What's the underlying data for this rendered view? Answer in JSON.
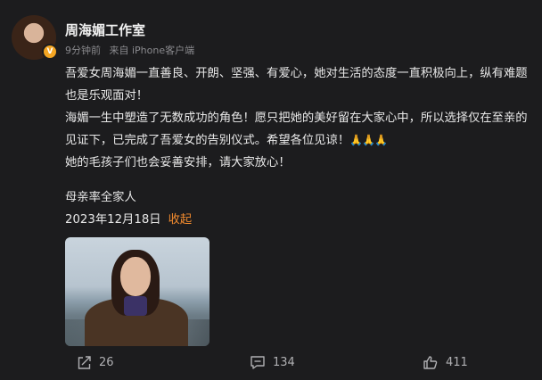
{
  "post": {
    "author": "周海媚工作室",
    "time": "9分钟前",
    "source": "来自 iPhone客户端",
    "paragraphs": [
      "吾爱女周海媚一直善良、开朗、坚强、有爱心，她对生活的态度一直积极向上，纵有难题也是乐观面对！",
      "海媚一生中塑造了无数成功的角色！愿只把她的美好留在大家心中，所以选择仅在至亲的见证下，已完成了吾爱女的告别仪式。希望各位见谅！",
      "她的毛孩子们也会妥善安排，请大家放心！"
    ],
    "emoji": "🙏",
    "signature": "母亲率全家人",
    "date": "2023年12月18日",
    "collapse_label": "收起"
  },
  "actions": {
    "share_count": "26",
    "comment_count": "134",
    "like_count": "411"
  },
  "icons": {
    "verified": "verified-badge-icon",
    "share": "share-icon",
    "comment": "comment-icon",
    "like": "thumbs-up-icon"
  },
  "colors": {
    "background": "#1c1c1e",
    "accent": "#f08a2e",
    "verified": "#f5a623",
    "muted": "#8a8a8e"
  }
}
